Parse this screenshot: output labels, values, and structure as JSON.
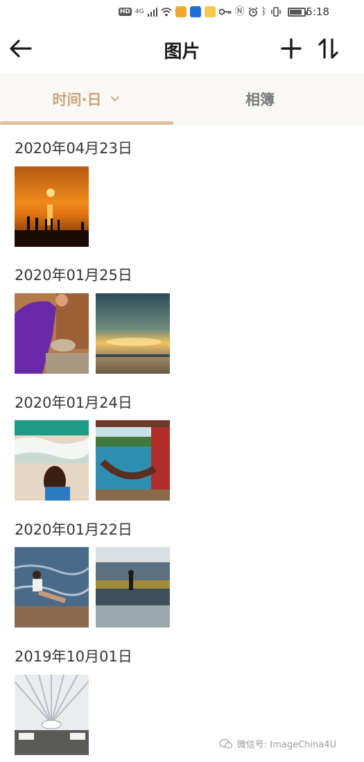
{
  "status_bar": {
    "hd": "HD",
    "network": "4G",
    "time": "5:18",
    "battery_level": 0.75
  },
  "header": {
    "title": "图片"
  },
  "tabs": [
    {
      "label": "时间·日",
      "active": true
    },
    {
      "label": "相簿",
      "active": false
    }
  ],
  "groups": [
    {
      "date": "2020年04月23日",
      "photos": [
        "sunset-silhouettes"
      ]
    },
    {
      "date": "2020年01月25日",
      "photos": [
        "man-purple-robe",
        "beach-sunset-clouds"
      ]
    },
    {
      "date": "2020年01月24日",
      "photos": [
        "girl-watching-waves",
        "hammock-boat"
      ]
    },
    {
      "date": "2020年01月22日",
      "photos": [
        "child-in-surf",
        "person-in-sea"
      ]
    },
    {
      "date": "2019年10月01日",
      "photos": [
        "airport-terminal"
      ]
    }
  ],
  "watermark": "微信号: ImageChina4U",
  "colors": {
    "accent": "#c9a57a",
    "indicator": "#ddc09b",
    "tab_bg": "#faf8f4"
  }
}
